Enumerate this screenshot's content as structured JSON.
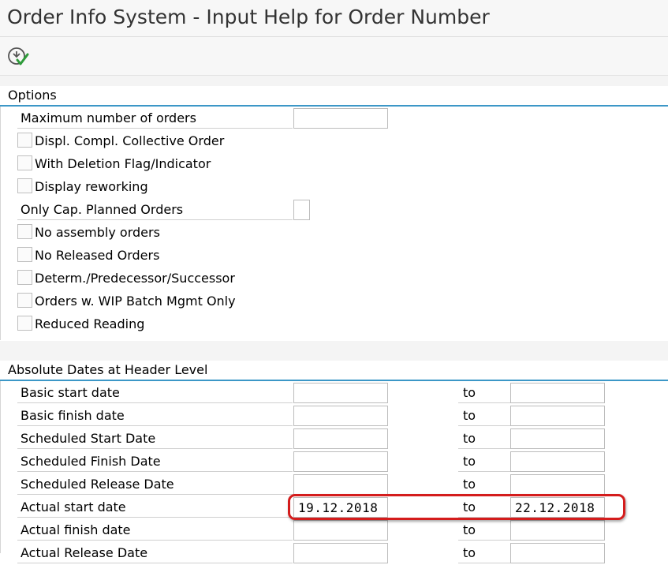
{
  "window": {
    "title": "Order Info System - Input Help for Order Number"
  },
  "toolbar": {
    "execute_icon": "execute-icon"
  },
  "options": {
    "title": "Options",
    "max_orders_label": "Maximum number of orders",
    "max_orders_value": "",
    "checkboxes": [
      {
        "label": "Displ. Compl. Collective Order",
        "checked": false
      },
      {
        "label": "With Deletion Flag/Indicator",
        "checked": false
      },
      {
        "label": "Display reworking",
        "checked": false
      }
    ],
    "cap_planned_label": "Only Cap. Planned Orders",
    "cap_planned_value": "",
    "checkboxes2": [
      {
        "label": "No assembly orders",
        "checked": false
      },
      {
        "label": "No Released Orders",
        "checked": false
      },
      {
        "label": "Determ./Predecessor/Successor",
        "checked": false
      },
      {
        "label": "Orders w. WIP Batch Mgmt Only",
        "checked": false
      },
      {
        "label": "Reduced Reading",
        "checked": false
      }
    ]
  },
  "dates": {
    "title": "Absolute Dates at Header Level",
    "to_label": "to",
    "rows": [
      {
        "label": "Basic start date",
        "from": "",
        "to": ""
      },
      {
        "label": "Basic finish date",
        "from": "",
        "to": ""
      },
      {
        "label": "Scheduled Start Date",
        "from": "",
        "to": ""
      },
      {
        "label": "Scheduled Finish Date",
        "from": "",
        "to": ""
      },
      {
        "label": "Scheduled Release Date",
        "from": "",
        "to": ""
      },
      {
        "label": "Actual start date",
        "from": "19.12.2018",
        "to": "22.12.2018"
      },
      {
        "label": "Actual finish date",
        "from": "",
        "to": ""
      },
      {
        "label": "Actual Release Date",
        "from": "",
        "to": ""
      }
    ]
  },
  "colors": {
    "accent": "#3c97c7",
    "highlight": "#d41c1c"
  }
}
